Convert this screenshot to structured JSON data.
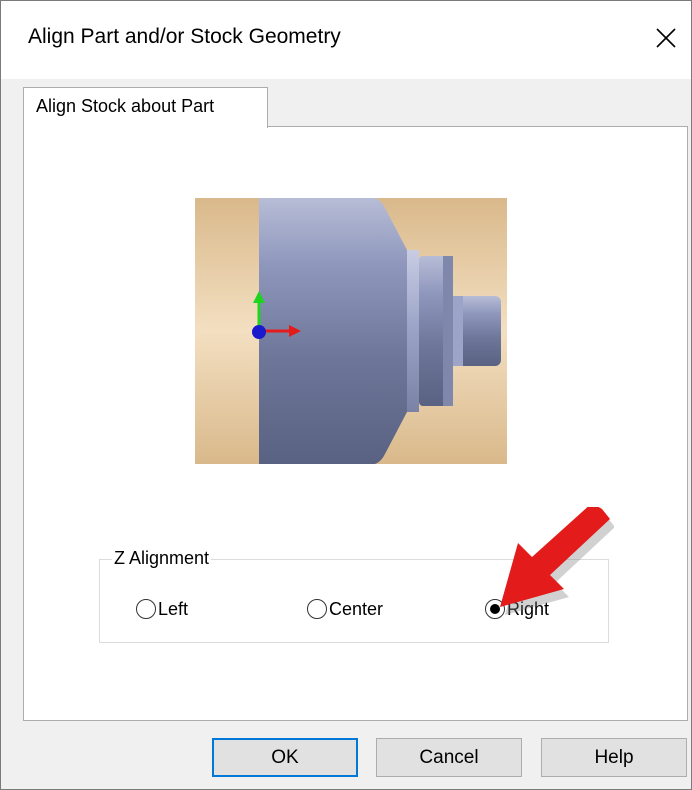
{
  "window": {
    "title": "Align Part and/or Stock Geometry",
    "close_glyph": "✕"
  },
  "tabs": [
    {
      "label": "Align Stock about Part",
      "active": true
    }
  ],
  "preview": {
    "icon": "lathe-part-stock-preview",
    "colors": {
      "stock": "#e4c9a0",
      "part": "#7d86aa"
    }
  },
  "z_alignment": {
    "label": "Z Alignment",
    "options": [
      {
        "label": "Left",
        "checked": false
      },
      {
        "label": "Center",
        "checked": false
      },
      {
        "label": "Right",
        "checked": true
      }
    ],
    "annotation_color": "#e31b1b"
  },
  "buttons": {
    "ok": "OK",
    "cancel": "Cancel",
    "help": "Help"
  }
}
